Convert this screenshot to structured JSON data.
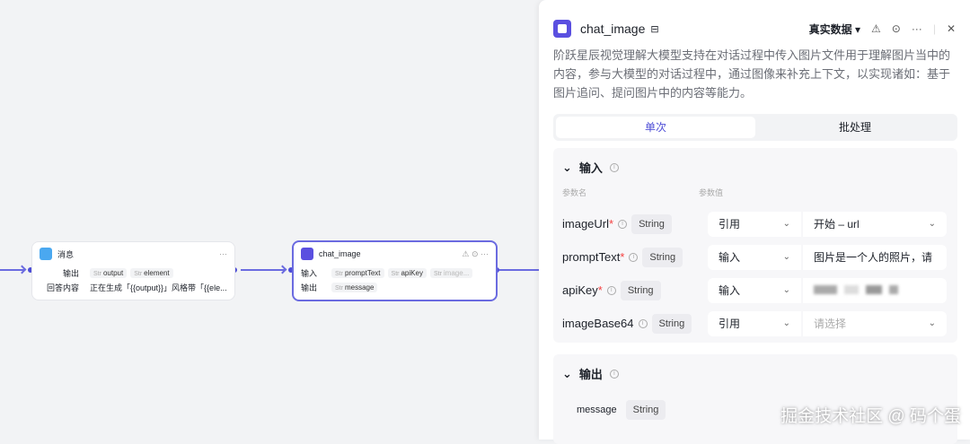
{
  "canvas": {
    "message_node": {
      "title": "消息",
      "output_label": "输出",
      "outputs": [
        "output",
        "element"
      ],
      "answer_label": "回答内容",
      "answer": "正在生成「{{output}}」风格带「{{ele..."
    },
    "chat_node": {
      "title": "chat_image",
      "input_label": "输入",
      "inputs": [
        "promptText",
        "apiKey",
        "image..."
      ],
      "output_label": "输出",
      "outputs": [
        "message"
      ]
    },
    "str_prefix": "Str"
  },
  "panel": {
    "title": "chat_image",
    "data_mode": "真实数据 ▾",
    "description": "阶跃星辰视觉理解大模型支持在对话过程中传入图片文件用于理解图片当中的内容，参与大模型的对话过程中，通过图像来补充上下文，以实现诸如：基于图片追问、提问图片中的内容等能力。",
    "tabs": [
      "单次",
      "批处理"
    ],
    "input_section": {
      "title": "输入",
      "col_name": "参数名",
      "col_value": "参数值",
      "params": [
        {
          "name": "imageUrl",
          "required": "*",
          "type": "String",
          "mode": "引用",
          "value": "开始 – url",
          "placeholder": false
        },
        {
          "name": "promptText",
          "required": "*",
          "type": "String",
          "mode": "输入",
          "value": "图片是一个人的照片，请",
          "placeholder": false
        },
        {
          "name": "apiKey",
          "required": "*",
          "type": "String",
          "mode": "输入",
          "value": "",
          "placeholder": false
        },
        {
          "name": "imageBase64",
          "required": "",
          "type": "String",
          "mode": "引用",
          "value": "请选择",
          "placeholder": true
        }
      ]
    },
    "output_section": {
      "title": "输出",
      "params": [
        {
          "name": "message",
          "type": "String"
        }
      ]
    }
  },
  "watermark": "掘金技术社区 @ 码个蛋"
}
